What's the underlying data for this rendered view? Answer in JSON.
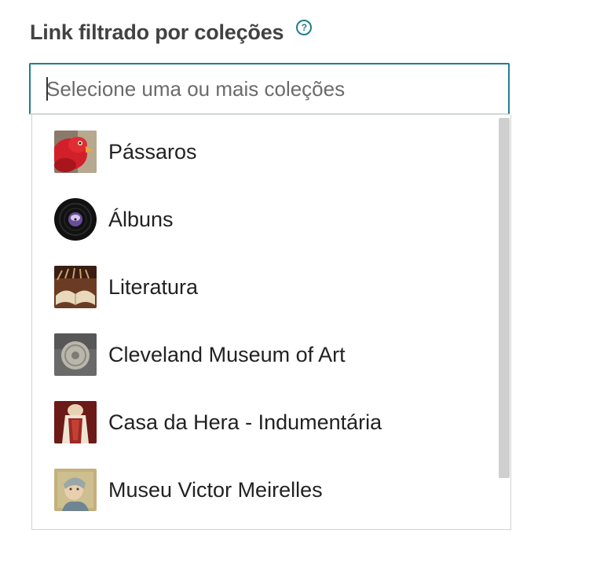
{
  "field": {
    "label": "Link filtrado por coleções",
    "help_icon": "question-circle-icon",
    "placeholder": "Selecione uma ou mais coleções",
    "value": ""
  },
  "accent_color": "#1f7f8c",
  "options": [
    {
      "label": "Pássaros",
      "thumbnail": "red-parrot-thumbnail"
    },
    {
      "label": "Álbuns",
      "thumbnail": "vinyl-record-thumbnail"
    },
    {
      "label": "Literatura",
      "thumbnail": "open-book-thumbnail"
    },
    {
      "label": "Cleveland Museum of Art",
      "thumbnail": "silver-coin-thumbnail"
    },
    {
      "label": "Casa da Hera - Indumentária",
      "thumbnail": "garment-thumbnail"
    },
    {
      "label": "Museu Victor Meirelles",
      "thumbnail": "portrait-painting-thumbnail"
    }
  ]
}
